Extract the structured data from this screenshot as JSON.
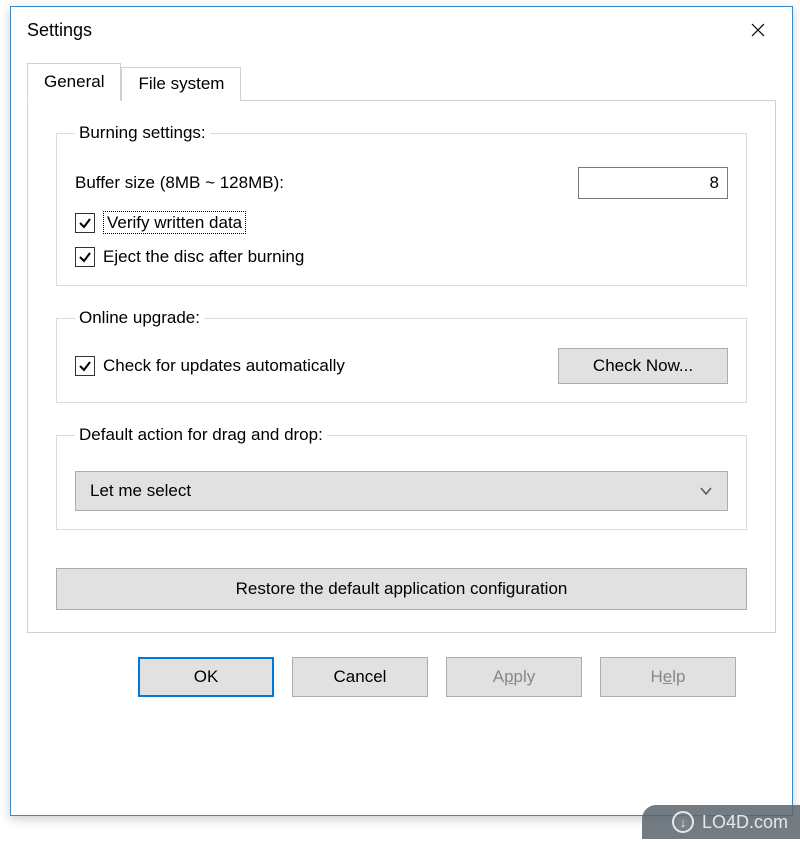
{
  "window": {
    "title": "Settings"
  },
  "tabs": {
    "general": "General",
    "filesystem": "File system"
  },
  "burning": {
    "legend": "Burning settings:",
    "buffer_label": "Buffer size (8MB ~ 128MB):",
    "buffer_value": "8",
    "verify_label": "Verify written data",
    "verify_checked": true,
    "eject_label": "Eject the disc after burning",
    "eject_checked": true
  },
  "online": {
    "legend": "Online upgrade:",
    "check_updates_label": "Check for updates automatically",
    "check_updates_checked": true,
    "check_now_label": "Check Now..."
  },
  "dragdrop": {
    "legend": "Default action for drag and drop:",
    "selected": "Let me select"
  },
  "restore_label": "Restore the default application configuration",
  "buttons": {
    "ok": "OK",
    "cancel": "Cancel",
    "apply_pre": "A",
    "apply_u": "p",
    "apply_post": "ply",
    "help_pre": "H",
    "help_u": "e",
    "help_post": "lp"
  },
  "watermark": "LO4D.com"
}
